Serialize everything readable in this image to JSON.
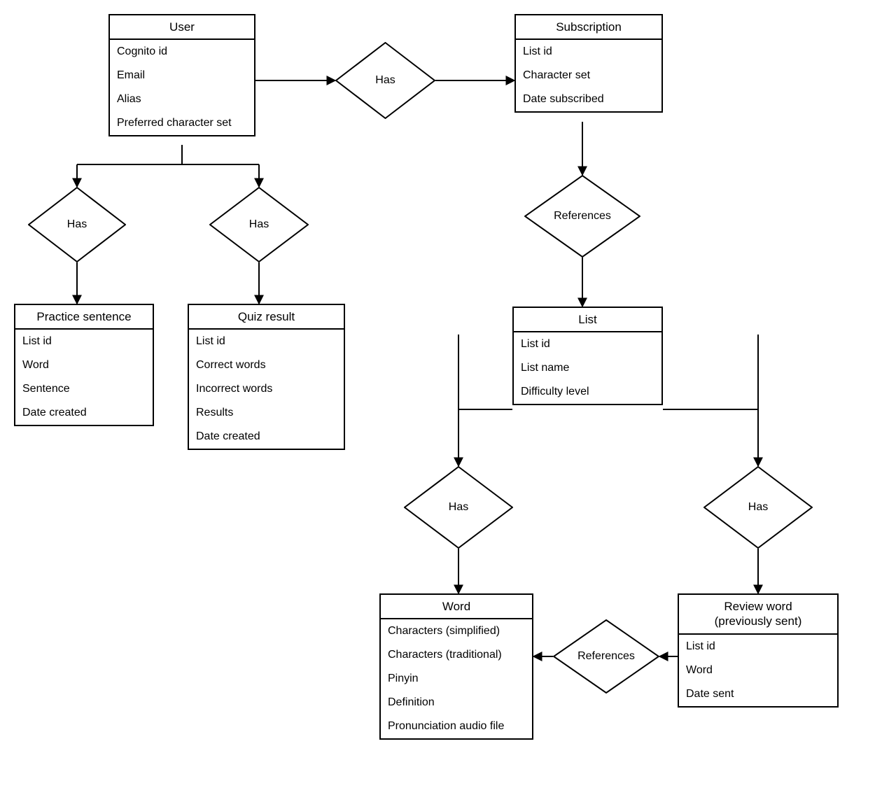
{
  "entities": {
    "user": {
      "title": "User",
      "attrs": [
        "Cognito id",
        "Email",
        "Alias",
        "Preferred character set"
      ]
    },
    "subscription": {
      "title": "Subscription",
      "attrs": [
        "List id",
        "Character set",
        "Date subscribed"
      ]
    },
    "practice_sentence": {
      "title": "Practice sentence",
      "attrs": [
        "List id",
        "Word",
        "Sentence",
        "Date created"
      ]
    },
    "quiz_result": {
      "title": "Quiz result",
      "attrs": [
        "List id",
        "Correct words",
        "Incorrect words",
        "Results",
        "Date created"
      ]
    },
    "list": {
      "title": "List",
      "attrs": [
        "List id",
        "List name",
        "Difficulty level"
      ]
    },
    "word": {
      "title": "Word",
      "attrs": [
        "Characters (simplified)",
        "Characters (traditional)",
        "Pinyin",
        "Definition",
        "Pronunciation audio file"
      ]
    },
    "review_word": {
      "title": "Review word\n(previously sent)",
      "attrs": [
        "List id",
        "Word",
        "Date sent"
      ]
    }
  },
  "relationships": {
    "user_subscription": "Has",
    "user_practice": "Has",
    "user_quiz": "Has",
    "subscription_list": "References",
    "list_word": "Has",
    "list_review": "Has",
    "review_word_ref": "References"
  }
}
